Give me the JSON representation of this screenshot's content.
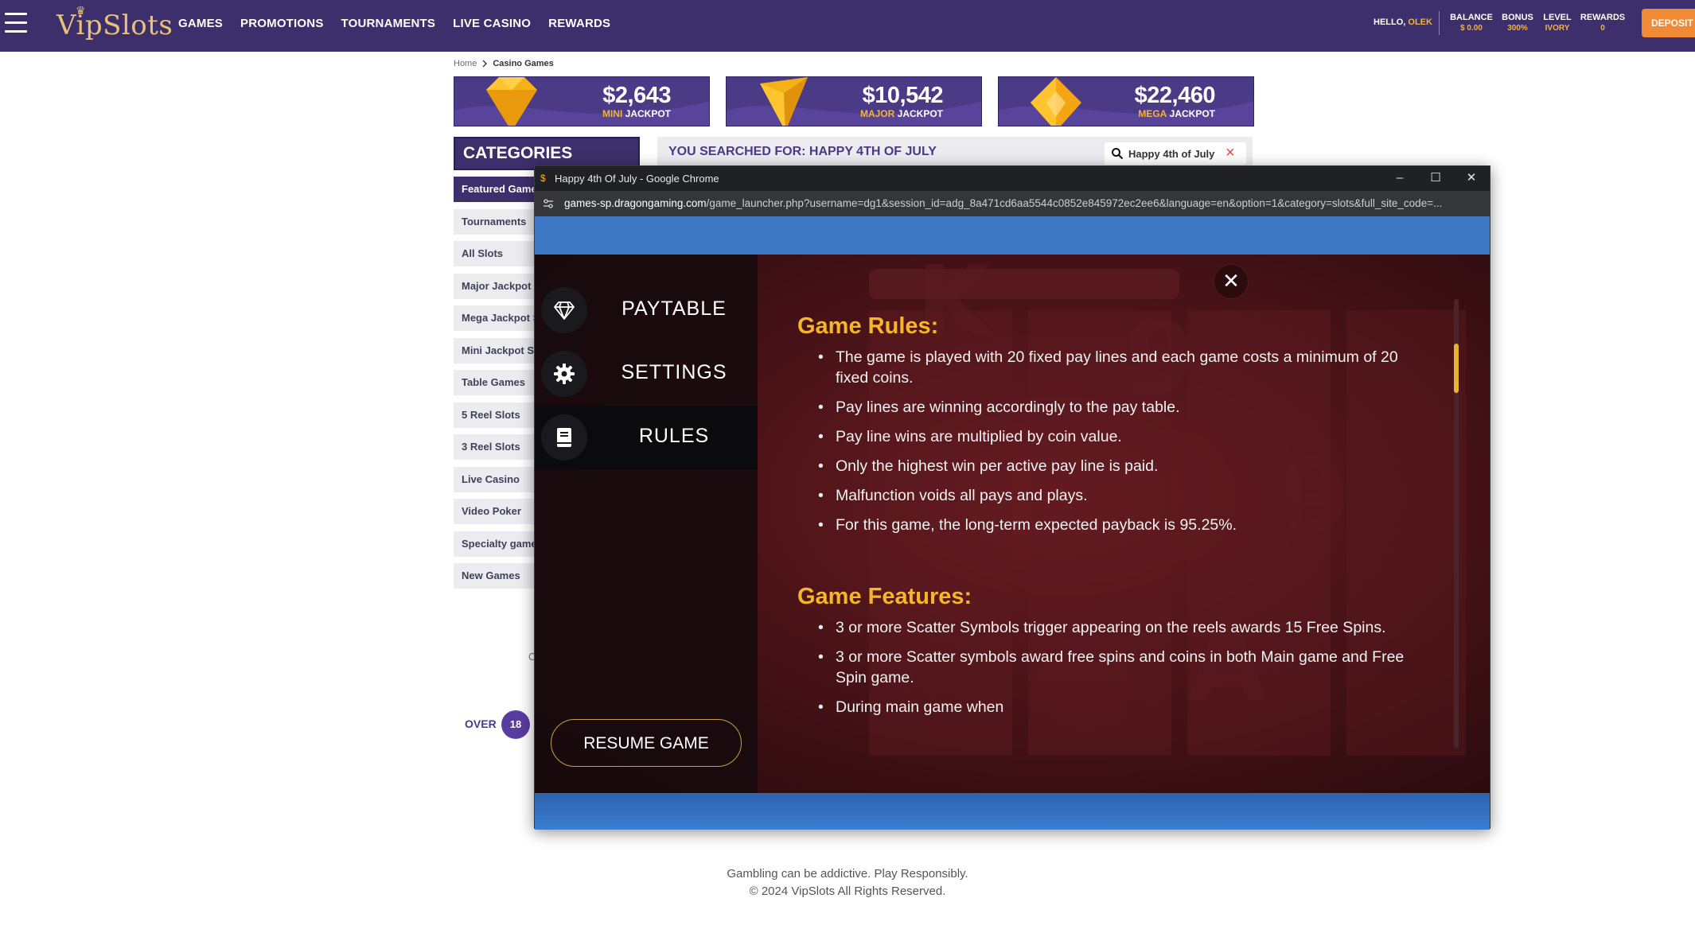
{
  "header": {
    "logo": "VipSlots",
    "nav": [
      "GAMES",
      "PROMOTIONS",
      "TOURNAMENTS",
      "LIVE CASINO",
      "REWARDS"
    ],
    "greeting": "HELLO,",
    "username": "OLEK",
    "stats": [
      {
        "label": "BALANCE",
        "value": "$ 0.00"
      },
      {
        "label": "BONUS",
        "value": "300%"
      },
      {
        "label": "LEVEL",
        "value": "IVORY"
      },
      {
        "label": "REWARDS",
        "value": "0"
      }
    ],
    "deposit_label": "DEPOSIT"
  },
  "breadcrumb": {
    "home": "Home",
    "current": "Casino Games"
  },
  "jackpots": [
    {
      "amount": "$2,643",
      "tier": "MINI",
      "word": "JACKPOT"
    },
    {
      "amount": "$10,542",
      "tier": "MAJOR",
      "word": "JACKPOT"
    },
    {
      "amount": "$22,460",
      "tier": "MEGA",
      "word": "JACKPOT"
    }
  ],
  "categories": {
    "title": "CATEGORIES",
    "items": [
      "Featured Games",
      "Tournaments",
      "All Slots",
      "Major Jackpot",
      "Mega Jackpot Slots",
      "Mini Jackpot Slots",
      "Table Games",
      "5 Reel Slots",
      "3 Reel Slots",
      "Live Casino",
      "Video Poker",
      "Specialty games",
      "New Games"
    ]
  },
  "search": {
    "results_title": "YOU SEARCHED FOR: HAPPY 4TH OF JULY",
    "query": "Happy 4th of July"
  },
  "age_notice": {
    "over": "OVER",
    "age": "18",
    "stray": "C"
  },
  "footer": {
    "line1": "Gambling can be addictive. Play Responsibly.",
    "line2": "© 2024 VipSlots All Rights Reserved."
  },
  "popup": {
    "window_title": "Happy 4th Of July - Google Chrome",
    "url_host": "games-sp.dragongaming.com",
    "url_path": "/game_launcher.php?username=dg1&session_id=adg_8a471cd6aa5544c0852e845972ec2ee6&language=en&option=1&category=slots&full_site_code=..."
  },
  "game_menu": {
    "items": [
      {
        "label": "PAYTABLE",
        "icon": "diamond-icon"
      },
      {
        "label": "SETTINGS",
        "icon": "gear-icon"
      },
      {
        "label": "RULES",
        "icon": "book-icon"
      }
    ],
    "active": "RULES",
    "resume_label": "RESUME GAME"
  },
  "rules": {
    "rules_heading": "Game Rules:",
    "rules_items": [
      "The game is played with 20 fixed pay lines and each game costs a minimum of 20 fixed coins.",
      "Pay lines are winning accordingly to the pay table.",
      "Pay line wins are multiplied by coin value.",
      "Only the highest win per active pay line is paid.",
      "Malfunction voids all pays and plays.",
      "For this game, the long-term expected payback is 95.25%."
    ],
    "features_heading": "Game Features:",
    "features_items": [
      "3 or more Scatter Symbols trigger appearing on the reels awards 15 Free Spins.",
      "3 or more Scatter symbols award free spins and coins in both Main game and Free Spin game.",
      "During main game when"
    ]
  },
  "colors": {
    "nav_bg": "#3d2f6b",
    "accent_gold": "#f3b33d",
    "deposit": "#f08a35",
    "rules_heading": "#f5b62a"
  }
}
